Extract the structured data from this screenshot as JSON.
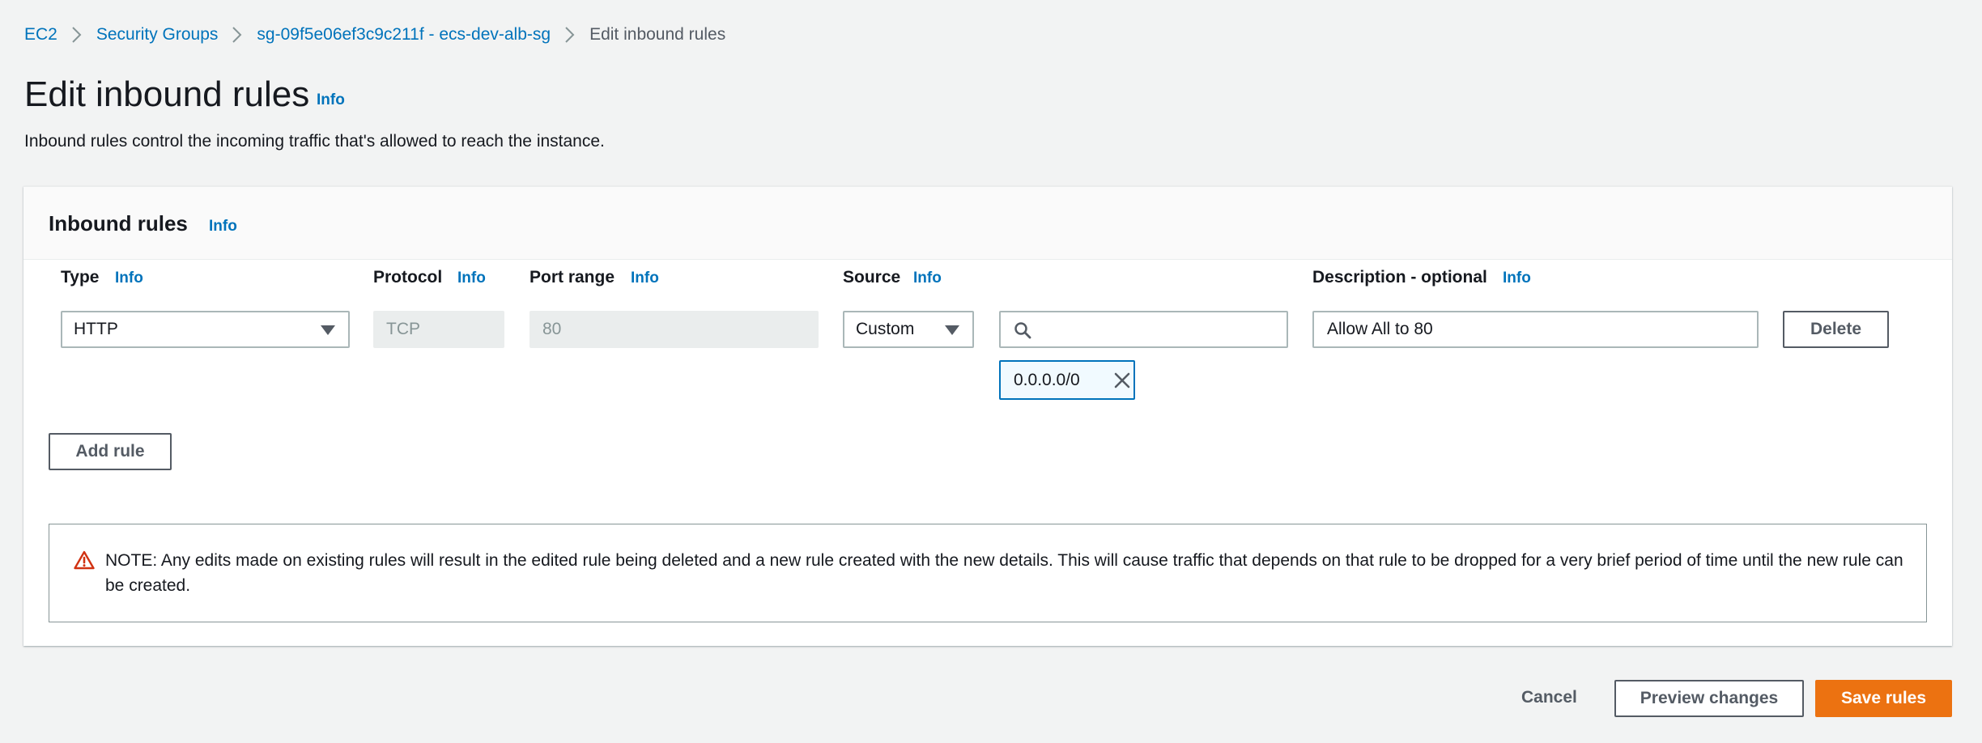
{
  "breadcrumb": {
    "items": [
      "EC2",
      "Security Groups",
      "sg-09f5e06ef3c9c211f - ecs-dev-alb-sg"
    ],
    "current": "Edit inbound rules"
  },
  "page": {
    "title": "Edit inbound rules",
    "info": "Info",
    "description": "Inbound rules control the incoming traffic that's allowed to reach the instance."
  },
  "card": {
    "title": "Inbound rules",
    "info": "Info",
    "columns": {
      "type": "Type",
      "protocol": "Protocol",
      "port_range": "Port range",
      "source": "Source",
      "description": "Description - optional",
      "info": "Info"
    },
    "rule": {
      "type": "HTTP",
      "protocol": "TCP",
      "port_range": "80",
      "source_type": "Custom",
      "source_search": "",
      "source_token": "0.0.0.0/0",
      "description": "Allow All to 80",
      "delete_label": "Delete"
    },
    "add_rule_label": "Add rule",
    "alert": "NOTE: Any edits made on existing rules will result in the edited rule being deleted and a new rule created with the new details. This will cause traffic that depends on that rule to be dropped for a very brief period of time until the new rule can be created."
  },
  "footer": {
    "cancel": "Cancel",
    "preview": "Preview changes",
    "save": "Save rules"
  },
  "colors": {
    "link": "#0073bb",
    "primary": "#ec7211",
    "warning": "#d13212",
    "background": "#f2f3f3"
  },
  "icons": {
    "breadcrumb_separator": "chevron-right-icon",
    "select_caret": "caret-down-icon",
    "search": "search-icon",
    "token_remove": "close-icon",
    "alert": "warning-icon"
  }
}
